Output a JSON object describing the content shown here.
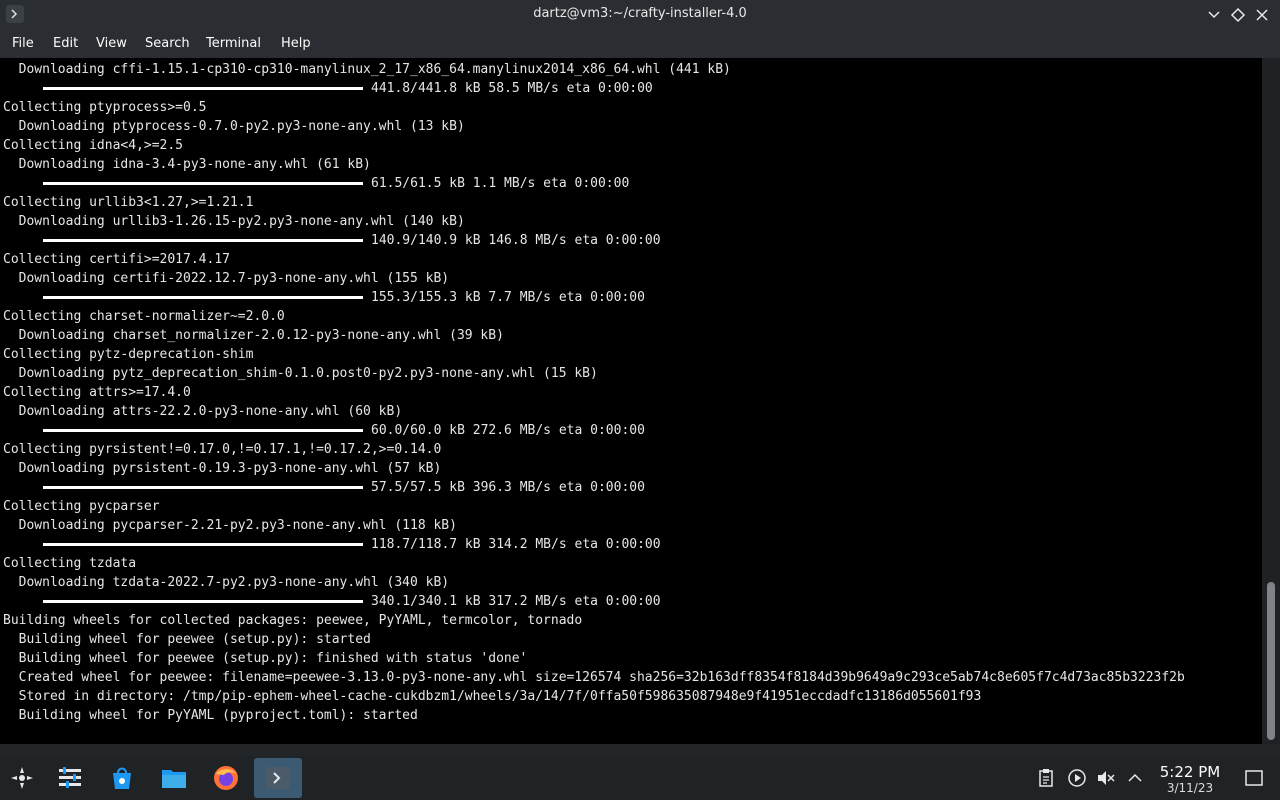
{
  "window": {
    "title": "dartz@vm3:~/crafty-installer-4.0"
  },
  "menu": [
    "File",
    "Edit",
    "View",
    "Search",
    "Terminal",
    "Help"
  ],
  "terminal": {
    "lines": [
      {
        "type": "text",
        "text": "  Downloading cffi-1.15.1-cp310-cp310-manylinux_2_17_x86_64.manylinux2014_x86_64.whl (441 kB)"
      },
      {
        "type": "progress",
        "text": "441.8/441.8 kB 58.5 MB/s eta 0:00:00"
      },
      {
        "type": "text",
        "text": "Collecting ptyprocess>=0.5"
      },
      {
        "type": "text",
        "text": "  Downloading ptyprocess-0.7.0-py2.py3-none-any.whl (13 kB)"
      },
      {
        "type": "text",
        "text": "Collecting idna<4,>=2.5"
      },
      {
        "type": "text",
        "text": "  Downloading idna-3.4-py3-none-any.whl (61 kB)"
      },
      {
        "type": "progress",
        "text": "61.5/61.5 kB 1.1 MB/s eta 0:00:00"
      },
      {
        "type": "text",
        "text": "Collecting urllib3<1.27,>=1.21.1"
      },
      {
        "type": "text",
        "text": "  Downloading urllib3-1.26.15-py2.py3-none-any.whl (140 kB)"
      },
      {
        "type": "progress",
        "text": "140.9/140.9 kB 146.8 MB/s eta 0:00:00"
      },
      {
        "type": "text",
        "text": "Collecting certifi>=2017.4.17"
      },
      {
        "type": "text",
        "text": "  Downloading certifi-2022.12.7-py3-none-any.whl (155 kB)"
      },
      {
        "type": "progress",
        "text": "155.3/155.3 kB 7.7 MB/s eta 0:00:00"
      },
      {
        "type": "text",
        "text": "Collecting charset-normalizer~=2.0.0"
      },
      {
        "type": "text",
        "text": "  Downloading charset_normalizer-2.0.12-py3-none-any.whl (39 kB)"
      },
      {
        "type": "text",
        "text": "Collecting pytz-deprecation-shim"
      },
      {
        "type": "text",
        "text": "  Downloading pytz_deprecation_shim-0.1.0.post0-py2.py3-none-any.whl (15 kB)"
      },
      {
        "type": "text",
        "text": "Collecting attrs>=17.4.0"
      },
      {
        "type": "text",
        "text": "  Downloading attrs-22.2.0-py3-none-any.whl (60 kB)"
      },
      {
        "type": "progress",
        "text": "60.0/60.0 kB 272.6 MB/s eta 0:00:00"
      },
      {
        "type": "text",
        "text": "Collecting pyrsistent!=0.17.0,!=0.17.1,!=0.17.2,>=0.14.0"
      },
      {
        "type": "text",
        "text": "  Downloading pyrsistent-0.19.3-py3-none-any.whl (57 kB)"
      },
      {
        "type": "progress",
        "text": "57.5/57.5 kB 396.3 MB/s eta 0:00:00"
      },
      {
        "type": "text",
        "text": "Collecting pycparser"
      },
      {
        "type": "text",
        "text": "  Downloading pycparser-2.21-py2.py3-none-any.whl (118 kB)"
      },
      {
        "type": "progress",
        "text": "118.7/118.7 kB 314.2 MB/s eta 0:00:00"
      },
      {
        "type": "text",
        "text": "Collecting tzdata"
      },
      {
        "type": "text",
        "text": "  Downloading tzdata-2022.7-py2.py3-none-any.whl (340 kB)"
      },
      {
        "type": "progress",
        "text": "340.1/340.1 kB 317.2 MB/s eta 0:00:00"
      },
      {
        "type": "text",
        "text": "Building wheels for collected packages: peewee, PyYAML, termcolor, tornado"
      },
      {
        "type": "text",
        "text": "  Building wheel for peewee (setup.py): started"
      },
      {
        "type": "text",
        "text": "  Building wheel for peewee (setup.py): finished with status 'done'"
      },
      {
        "type": "text",
        "text": "  Created wheel for peewee: filename=peewee-3.13.0-py3-none-any.whl size=126574 sha256=32b163dff8354f8184d39b9649a9c293ce5ab74c8e605f7c4d73ac85b3223f2b"
      },
      {
        "type": "text",
        "text": "  Stored in directory: /tmp/pip-ephem-wheel-cache-cukdbzm1/wheels/3a/14/7f/0ffa50f598635087948e9f41951eccdadfc13186d055601f93"
      },
      {
        "type": "text",
        "text": "  Building wheel for PyYAML (pyproject.toml): started"
      }
    ]
  },
  "taskbar": {
    "items": [
      "app-launcher-icon",
      "system-settings-icon",
      "discover-store-icon",
      "file-manager-icon",
      "firefox-icon",
      "terminal-icon"
    ],
    "tray": [
      "clipboard-icon",
      "media-player-icon",
      "volume-muted-icon",
      "show-hidden-icon"
    ],
    "time": "5:22 PM",
    "date": "3/11/23"
  }
}
